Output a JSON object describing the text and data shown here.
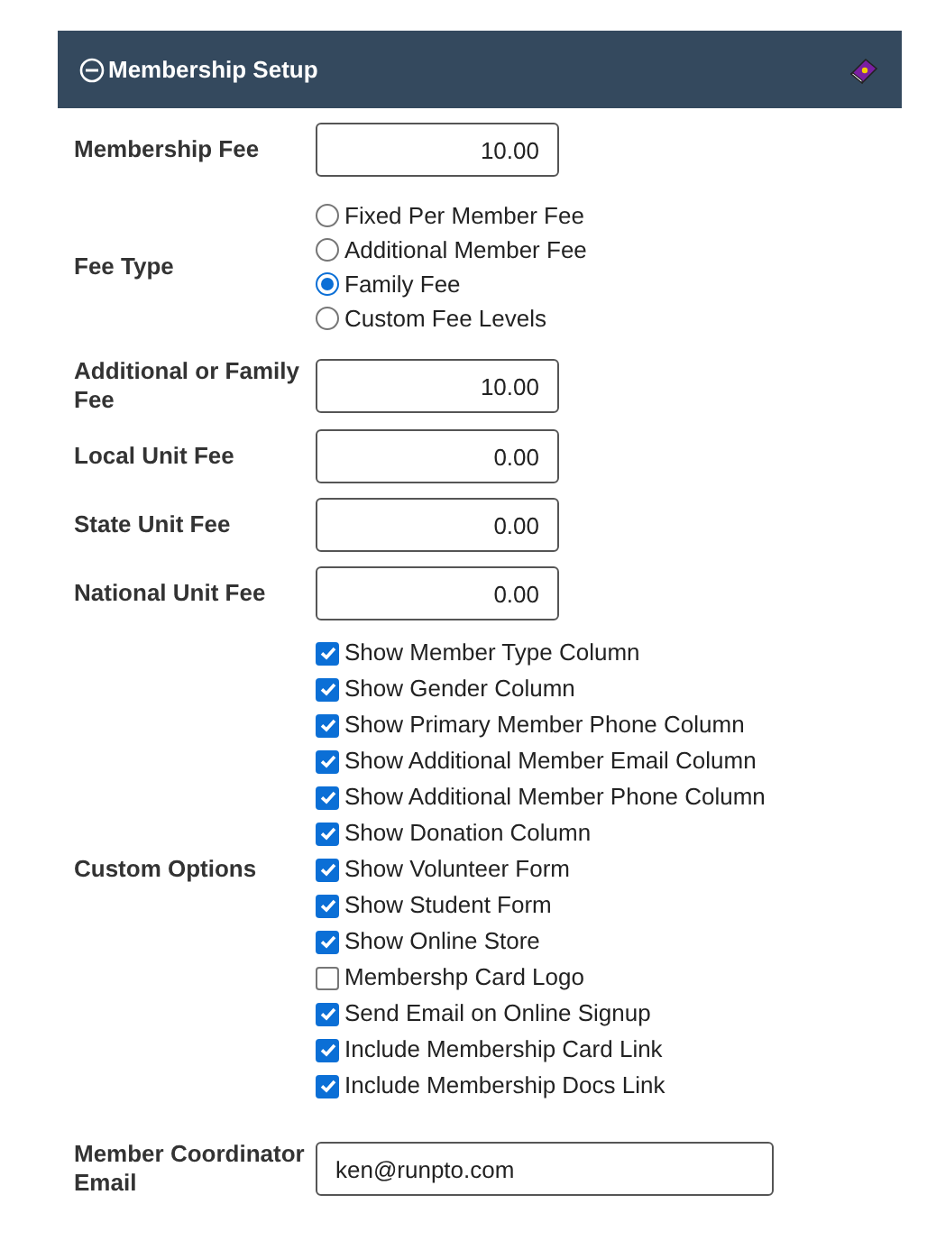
{
  "header": {
    "title": "Membership Setup"
  },
  "rows": [
    {
      "kind": "amount",
      "label": "Membership Fee",
      "value": "10.00"
    },
    {
      "kind": "radio",
      "label": "Fee Type",
      "options": [
        {
          "label": "Fixed Per Member Fee",
          "selected": false
        },
        {
          "label": "Additional Member Fee",
          "selected": false
        },
        {
          "label": "Family Fee",
          "selected": true
        },
        {
          "label": "Custom Fee Levels",
          "selected": false
        }
      ]
    },
    {
      "kind": "amount",
      "label": "Additional or Family Fee",
      "value": "10.00"
    },
    {
      "kind": "amount",
      "label": "Local Unit Fee",
      "value": "0.00"
    },
    {
      "kind": "amount",
      "label": "State Unit Fee",
      "value": "0.00"
    },
    {
      "kind": "amount",
      "label": "National Unit Fee",
      "value": "0.00"
    },
    {
      "kind": "checks",
      "label": "Custom Options",
      "options": [
        {
          "label": "Show Member Type Column",
          "checked": true
        },
        {
          "label": "Show Gender Column",
          "checked": true
        },
        {
          "label": "Show Primary Member Phone Column",
          "checked": true
        },
        {
          "label": "Show Additional Member Email Column",
          "checked": true
        },
        {
          "label": "Show Additional Member Phone Column",
          "checked": true
        },
        {
          "label": "Show Donation Column",
          "checked": true
        },
        {
          "label": "Show Volunteer Form",
          "checked": true
        },
        {
          "label": "Show Student Form",
          "checked": true
        },
        {
          "label": "Show Online Store",
          "checked": true
        },
        {
          "label": "Membershp Card Logo",
          "checked": false
        },
        {
          "label": "Send Email on Online Signup",
          "checked": true
        },
        {
          "label": "Include Membership Card Link",
          "checked": true
        },
        {
          "label": "Include Membership Docs Link",
          "checked": true
        }
      ]
    },
    {
      "kind": "email",
      "label": "Member Coordinator Email",
      "value": "ken@runpto.com"
    }
  ]
}
